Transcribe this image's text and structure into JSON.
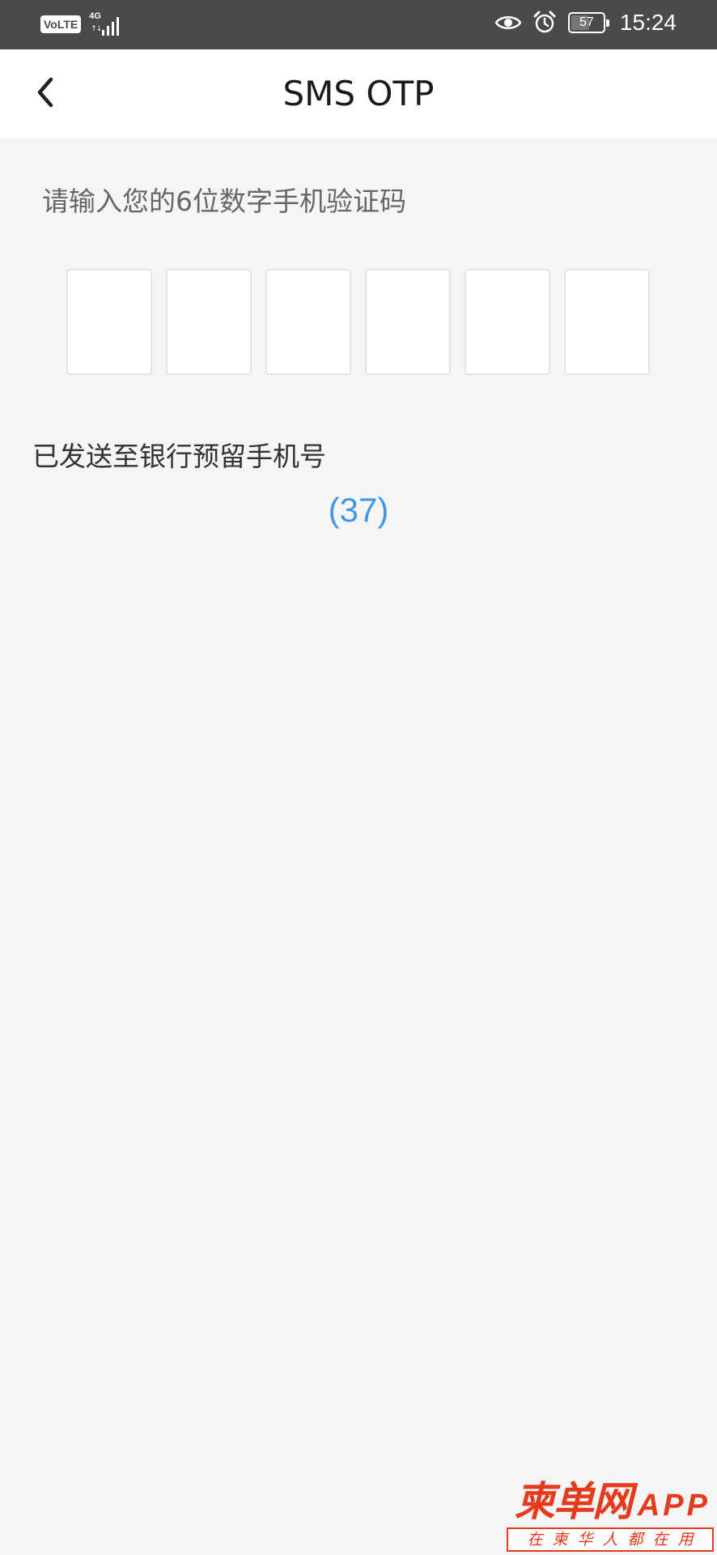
{
  "status_bar": {
    "volte_label": "VoLTE",
    "network_label": "4G",
    "network_arrows": "↑↓",
    "signal_bars": 4,
    "battery_level": "57",
    "battery_fraction": 0.57,
    "time": "15:24",
    "icons": [
      "eye-icon",
      "alarm-icon",
      "battery-icon"
    ]
  },
  "nav": {
    "back_icon": "chevron-left-icon",
    "title": "SMS OTP"
  },
  "otp": {
    "prompt": "请输入您的6位数字手机验证码",
    "digit_count": 6,
    "digits": [
      "",
      "",
      "",
      "",
      "",
      ""
    ]
  },
  "sent_notice": "已发送至银行预留手机号",
  "countdown": "(37)",
  "watermark": {
    "logo_text": "柬单网",
    "logo_suffix": "APP",
    "slogan": "在柬华人都在用"
  },
  "colors": {
    "status_bar_bg": "#4a4a4a",
    "nav_bg": "#ffffff",
    "page_bg": "#f5f5f5",
    "countdown": "#3f9ae3",
    "watermark": "#e63a1d"
  }
}
